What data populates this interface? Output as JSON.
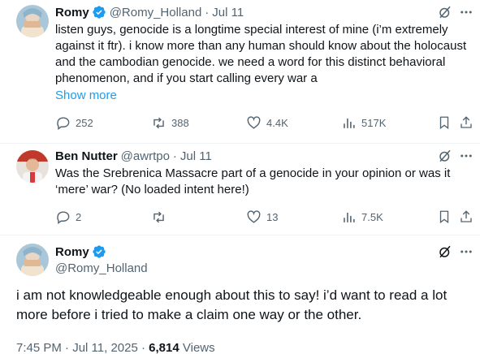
{
  "tweets": [
    {
      "name": "Romy",
      "handle": "@Romy_Holland",
      "dot": "·",
      "date": "Jul 11",
      "text": "listen guys, genocide is a longtime special interest of mine (i’m extremely against it ftr). i know more than any human should know about the holocaust and the cambodian genocide. we need a word for this distinct behavioral phenomenon, and if you start calling every war a",
      "show_more": "Show more",
      "replies": "252",
      "reposts": "388",
      "likes": "4.4K",
      "views": "517K"
    },
    {
      "name": "Ben Nutter",
      "handle": "@awrtpo",
      "dot": "·",
      "date": "Jul 11",
      "text": "Was the Srebrenica Massacre part of a genocide in your opinion or was it ‘mere’ war? (No loaded intent here!)",
      "replies": "2",
      "reposts": "",
      "likes": "13",
      "views": "7.5K"
    }
  ],
  "main": {
    "name": "Romy",
    "handle": "@Romy_Holland",
    "text": "i am not knowledgeable enough about this to say! i’d want to read a lot more before i tried to make a claim one way or the other.",
    "time": "7:45 PM · Jul 11, 2025 ·",
    "views_count": "6,814",
    "views_label": "Views"
  },
  "colors": {
    "text": "#0f1419",
    "muted": "#536471",
    "link": "#1d9bf0",
    "verified": "#1d9bf0"
  },
  "icons": {
    "verified": "verified-badge-icon",
    "grok": "grok-icon",
    "more": "more-icon",
    "reply": "reply-icon",
    "repost": "repost-icon",
    "like": "like-icon",
    "views": "views-icon",
    "bookmark": "bookmark-icon",
    "share": "share-icon"
  }
}
